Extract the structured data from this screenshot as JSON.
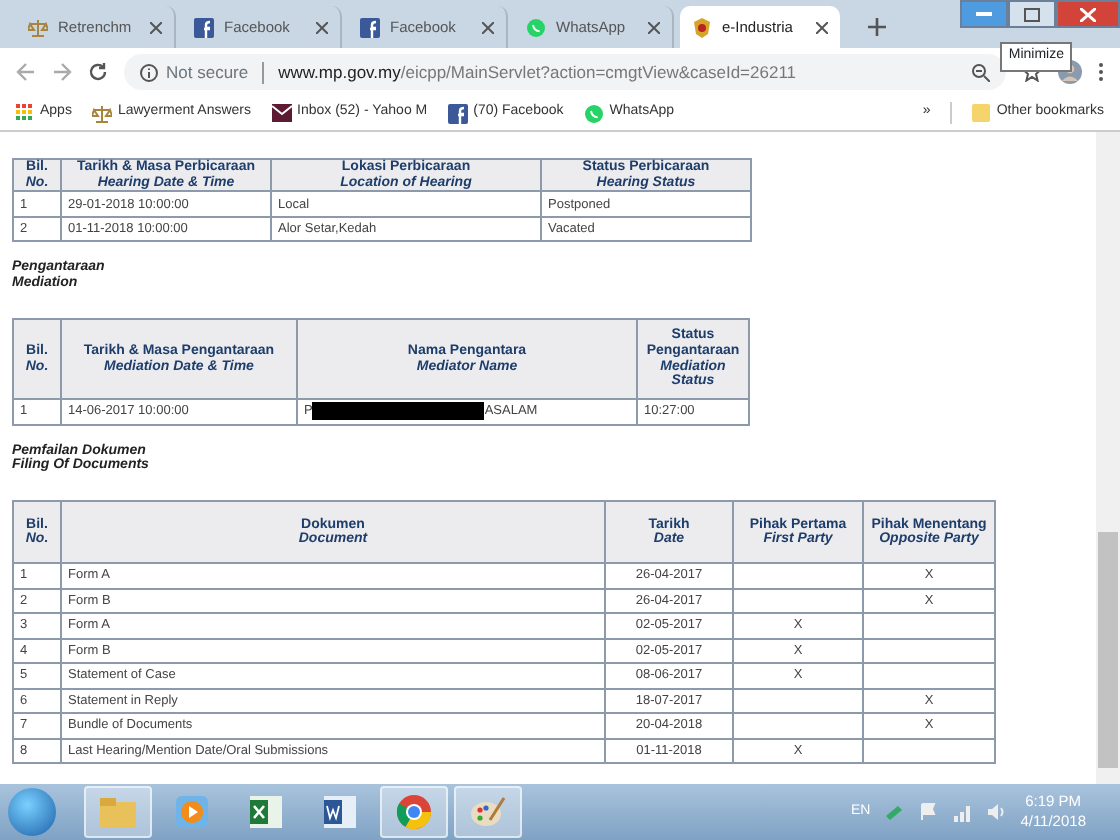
{
  "browser": {
    "tabs": [
      {
        "title": "Retrenchm",
        "selected": false
      },
      {
        "title": "Facebook",
        "selected": false
      },
      {
        "title": "Facebook",
        "selected": false
      },
      {
        "title": "WhatsApp",
        "selected": false
      },
      {
        "title": "e-Industria",
        "selected": true
      }
    ],
    "tooltip": "Minimize",
    "address": {
      "security": "Not secure",
      "host": "www.mp.gov.my",
      "path": "/eicpp/MainServlet?action=cmgtView&caseId=26211"
    },
    "bookmarks": [
      {
        "label": "Apps"
      },
      {
        "label": "Lawyerment Answers"
      },
      {
        "label": "Inbox (52) - Yahoo M"
      },
      {
        "label": "(70) Facebook"
      },
      {
        "label": "WhatsApp"
      }
    ],
    "more_bookmarks": "»",
    "other_bookmarks": "Other bookmarks"
  },
  "hearing_table": {
    "columns": [
      {
        "label": "Bil.",
        "label_en": "No."
      },
      {
        "label": "Tarikh & Masa Perbicaraan",
        "label_en": "Hearing Date & Time"
      },
      {
        "label": "Lokasi Perbicaraan",
        "label_en": "Location of Hearing"
      },
      {
        "label": "Status Perbicaraan",
        "label_en": "Hearing Status"
      }
    ],
    "rows": [
      [
        "1",
        "29-01-2018 10:00:00",
        "Local",
        "Postponed"
      ],
      [
        "2",
        "01-11-2018 10:00:00",
        "Alor Setar,Kedah",
        "Vacated"
      ]
    ]
  },
  "mediation": {
    "heading": "Pengantaraan",
    "heading_en": "Mediation",
    "columns": [
      {
        "label": "Bil.",
        "label_en": "No."
      },
      {
        "label": "Tarikh & Masa Pengantaraan",
        "label_en": "Mediation Date & Time"
      },
      {
        "label": "Nama Pengantara",
        "label_en": "Mediator Name"
      },
      {
        "label": "Status Pengantaraan",
        "label_en": "Mediation Status"
      }
    ],
    "rows": [
      {
        "no": "1",
        "date": "14-06-2017 10:00:00",
        "name_start": "P",
        "name_end": "ASALAM",
        "redacted": true,
        "status": "10:27:00"
      }
    ]
  },
  "documents": {
    "heading": "Pemfailan Dokumen",
    "heading_en": "Filing Of Documents",
    "columns": [
      {
        "label": "Bil.",
        "label_en": "No."
      },
      {
        "label": "Dokumen",
        "label_en": "Document"
      },
      {
        "label": "Tarikh",
        "label_en": "Date"
      },
      {
        "label": "Pihak Pertama",
        "label_en": "First Party"
      },
      {
        "label": "Pihak Menentang",
        "label_en": "Opposite Party"
      }
    ],
    "rows": [
      {
        "no": "1",
        "document": "Form A",
        "date": "26-04-2017",
        "opposite_party": "X"
      },
      {
        "no": "2",
        "document": "Form B",
        "date": "26-04-2017",
        "opposite_party": "X"
      },
      {
        "no": "3",
        "document": "Form A",
        "date": "02-05-2017",
        "first_party": "X"
      },
      {
        "no": "4",
        "document": "Form B",
        "date": "02-05-2017",
        "first_party": "X"
      },
      {
        "no": "5",
        "document": "Statement of Case",
        "date": "08-06-2017",
        "first_party": "X"
      },
      {
        "no": "6",
        "document": "Statement in Reply",
        "date": "18-07-2017",
        "opposite_party": "X"
      },
      {
        "no": "7",
        "document": "Bundle of Documents",
        "date": "20-04-2018",
        "opposite_party": "X"
      },
      {
        "no": "8",
        "document": "Last Hearing/Mention Date/Oral Submissions",
        "date": "01-11-2018",
        "first_party": "X"
      }
    ]
  },
  "taskbar": {
    "language": "EN",
    "time": "6:19 PM",
    "date": "4/11/2018"
  }
}
